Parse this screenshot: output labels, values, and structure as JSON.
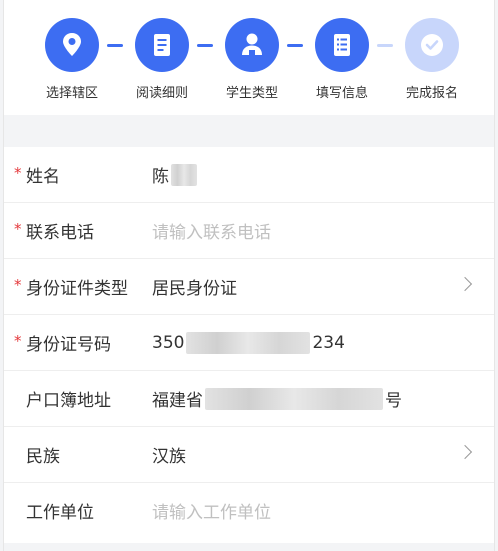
{
  "steps": [
    {
      "label": "选择辖区",
      "icon": "location-pin-icon",
      "state": "done"
    },
    {
      "label": "阅读细则",
      "icon": "document-icon",
      "state": "done"
    },
    {
      "label": "学生类型",
      "icon": "student-icon",
      "state": "done"
    },
    {
      "label": "填写信息",
      "icon": "form-icon",
      "state": "current"
    },
    {
      "label": "完成报名",
      "icon": "checkmark-icon",
      "state": "pending"
    }
  ],
  "colors": {
    "accent": "#3d6df2",
    "accent_light": "#c8d6fb",
    "required": "#e4393c"
  },
  "form": {
    "name": {
      "label": "姓名",
      "value_prefix": "陈",
      "required": true
    },
    "phone": {
      "label": "联系电话",
      "placeholder": "请输入联系电话",
      "required": true
    },
    "id_type": {
      "label": "身份证件类型",
      "value": "居民身份证",
      "required": true
    },
    "id_number": {
      "label": "身份证号码",
      "value_prefix": "350",
      "value_suffix": "234",
      "required": true
    },
    "address": {
      "label": "户口簿地址",
      "value_prefix": "福建省",
      "value_suffix": "号",
      "required": false
    },
    "ethnicity": {
      "label": "民族",
      "value": "汉族",
      "required": false
    },
    "employer": {
      "label": "工作单位",
      "placeholder": "请输入工作单位",
      "required": false
    }
  },
  "required_mark": "*"
}
